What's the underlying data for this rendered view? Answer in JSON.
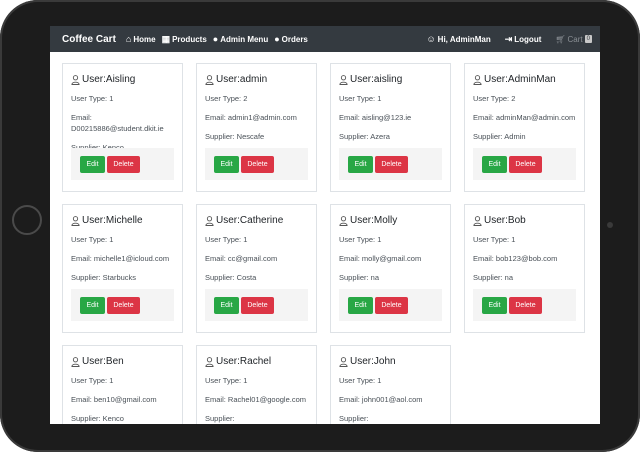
{
  "navbar": {
    "brand": "Coffee Cart",
    "links": [
      {
        "label": "Home",
        "icon": "home-icon"
      },
      {
        "label": "Products",
        "icon": "products-icon"
      },
      {
        "label": "Admin Menu",
        "icon": "admin-menu-icon"
      },
      {
        "label": "Orders",
        "icon": "orders-icon"
      }
    ],
    "greeting": "Hi, AdminMan",
    "logout": "Logout",
    "cart": "Cart",
    "cart_count": "0"
  },
  "labels": {
    "user_prefix": "User: ",
    "edit": "Edit",
    "delete": "Delete"
  },
  "users": [
    {
      "name": "Aisling",
      "type": "User Type: 1",
      "email": "Email: D00215886@student.dkit.ie",
      "supplier": "Supplier: Kenco"
    },
    {
      "name": "admin",
      "type": "User Type: 2",
      "email": "Email: admin1@admin.com",
      "supplier": "Supplier: Nescafe"
    },
    {
      "name": "aisling",
      "type": "User Type: 1",
      "email": "Email: aisling@123.ie",
      "supplier": "Supplier: Azera"
    },
    {
      "name": "AdminMan",
      "type": "User Type: 2",
      "email": "Email: adminMan@admin.com",
      "supplier": "Supplier: Admin"
    },
    {
      "name": "Michelle",
      "type": "User Type: 1",
      "email": "Email: michelle1@icloud.com",
      "supplier": "Supplier: Starbucks"
    },
    {
      "name": "Catherine",
      "type": "User Type: 1",
      "email": "Email: cc@gmail.com",
      "supplier": "Supplier: Costa"
    },
    {
      "name": "Molly",
      "type": "User Type: 1",
      "email": "Email: molly@gmail.com",
      "supplier": "Supplier: na"
    },
    {
      "name": "Bob",
      "type": "User Type: 1",
      "email": "Email: bob123@bob.com",
      "supplier": "Supplier: na"
    },
    {
      "name": "Ben",
      "type": "User Type: 1",
      "email": "Email: ben10@gmail.com",
      "supplier": "Supplier: Kenco"
    },
    {
      "name": "Rachel",
      "type": "User Type: 1",
      "email": "Email: Rachel01@google.com",
      "supplier": "Supplier:"
    },
    {
      "name": "John",
      "type": "User Type: 1",
      "email": "Email: john001@aol.com",
      "supplier": "Supplier:"
    }
  ],
  "colors": {
    "navbar": "#343a40",
    "edit": "#28a745",
    "delete": "#dc3545"
  }
}
